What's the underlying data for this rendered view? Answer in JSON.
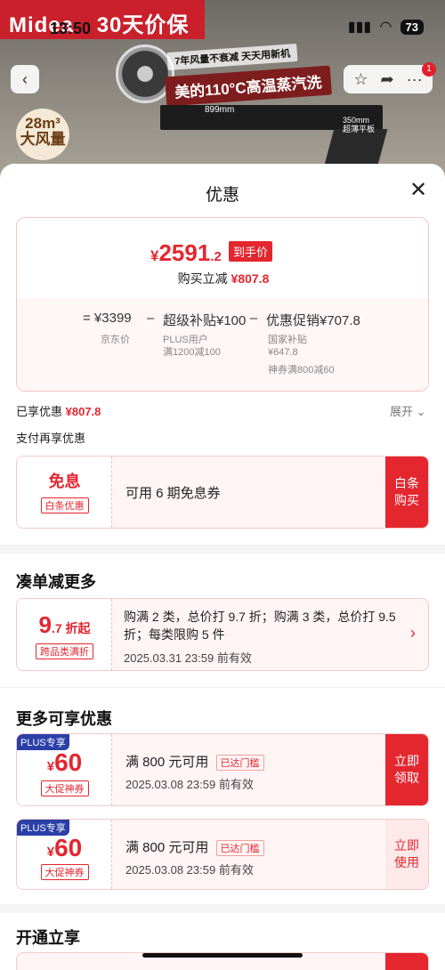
{
  "status_bar": {
    "time": "13:50",
    "battery": "73"
  },
  "hero": {
    "brand": "Midea",
    "brand_slogan": "30天价保",
    "promo_small": "7年风量不衰减 天天用新机",
    "promo_main": "美的110°C高温蒸汽洗",
    "width_label": "899mm",
    "height_label": "350mm 超薄平板",
    "airflow_value": "28m³",
    "airflow_label": "大风量",
    "badge_count": "1"
  },
  "sheet": {
    "title": "优惠",
    "final_price": {
      "yen": "¥",
      "int": "2591",
      "dec": ".2"
    },
    "hand_price_tag": "到手价",
    "save_prefix": "购买立减",
    "save_amount": "¥807.8",
    "formula": {
      "jd_price": "= ¥3399",
      "minus1": "–",
      "subsidy": "超级补贴¥100",
      "minus2": "–",
      "promo": "优惠促销¥707.8",
      "jd_label": "京东价",
      "plus_label1": "PLUS用户",
      "plus_label2": "满1200减100",
      "nation_label1": "国家补贴",
      "nation_label2": "¥647.8",
      "coupon_label": "神券满800减60"
    },
    "enjoyed_label": "已享优惠",
    "enjoyed_amount": "¥807.8",
    "expand_label": "展开",
    "pay_more_label": "支付再享优惠",
    "baitiao": {
      "title": "免息",
      "tag": "白条优惠",
      "desc": "可用 6 期免息券",
      "cta": "白条购买"
    },
    "section_more_order": "凑单减更多",
    "discount": {
      "big": "9",
      "small": ".7 折起",
      "tag": "跨品类满折",
      "desc": "购满 2 类，总价打 9.7 折；购满 3 类，总价打 9.5 折；每类限购 5 件",
      "valid": "2025.03.31 23:59 前有效"
    },
    "section_more_coupons": "更多可享优惠",
    "coupons": [
      {
        "plus_tag": "PLUS专享",
        "amount": "60",
        "yen": "¥",
        "tag": "大促神券",
        "title": "满 800 元可用",
        "threshold": "已达门槛",
        "valid": "2025.03.08 23:59 前有效",
        "cta": "立即领取"
      },
      {
        "plus_tag": "PLUS专享",
        "amount": "60",
        "yen": "¥",
        "tag": "大促神券",
        "title": "满 800 元可用",
        "threshold": "已达门槛",
        "valid": "2025.03.08 23:59 前有效",
        "cta": "立即使用"
      }
    ],
    "section_open": "开通立享"
  },
  "colors": {
    "accent": "#e4262f",
    "plus": "#2a3fa8",
    "brand": "#c9202c"
  },
  "icons": [
    "back-icon",
    "star-icon",
    "share-icon",
    "more-icon",
    "close-icon",
    "chevron-down-icon",
    "chevron-right-icon"
  ]
}
